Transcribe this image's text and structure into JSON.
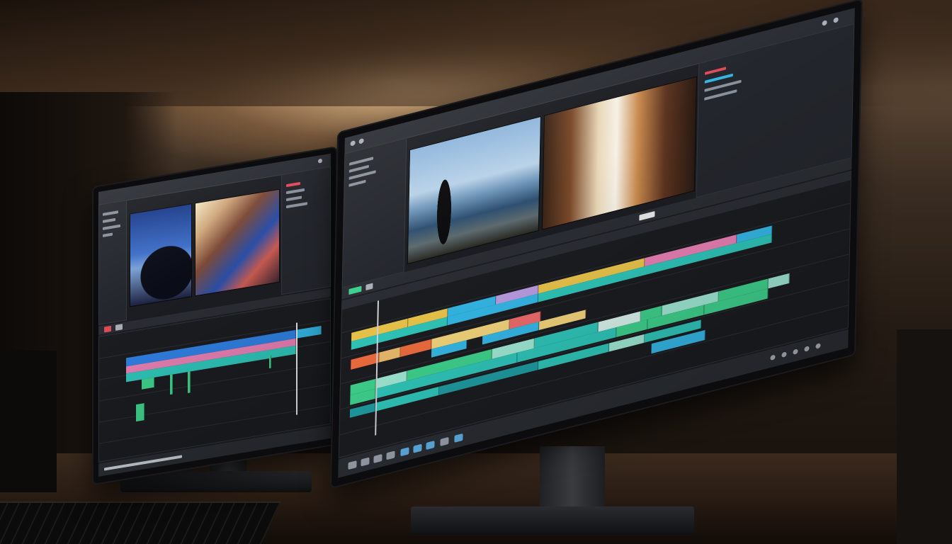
{
  "scene": {
    "description_free": true
  },
  "colors": {
    "timeline_yellow": "#e8c34a",
    "timeline_teal": "#2fc4b8",
    "timeline_cyan": "#34b6e4",
    "timeline_pink": "#e57fb3",
    "timeline_orange": "#ec6b3e",
    "timeline_green": "#3ed08c",
    "timeline_blue": "#2f7fe0",
    "accent_red": "#e14b5a",
    "accent_green": "#3ed08c"
  },
  "icons": {
    "close": "close-icon",
    "settings": "gear-icon",
    "play": "play-icon",
    "tool": "toolbar-icon"
  }
}
